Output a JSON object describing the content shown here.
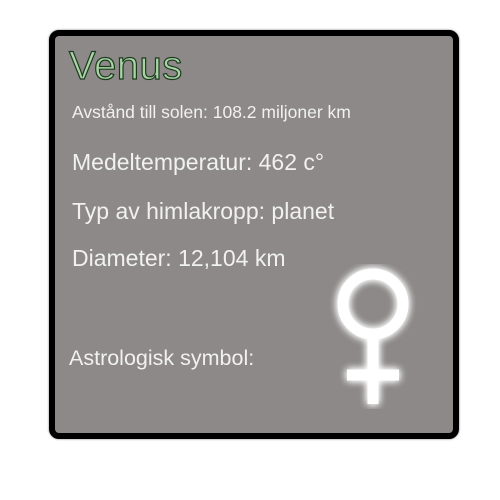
{
  "card": {
    "title": "Venus",
    "distance": "Avstånd till solen: 108.2 miljoner km",
    "temperature": "Medeltemperatur: 462 c°",
    "body_type": "Typ av himlakropp: planet",
    "diameter": "Diameter: 12,104 km",
    "astro_label": "Astrologisk symbol:",
    "symbol_icon": "venus-symbol-icon"
  },
  "colors": {
    "card_background": "#8c8988",
    "card_border": "#000000",
    "title_fill": "#a9d5a6",
    "text": "#f1f1f1",
    "symbol_glow": "#ffffff"
  }
}
